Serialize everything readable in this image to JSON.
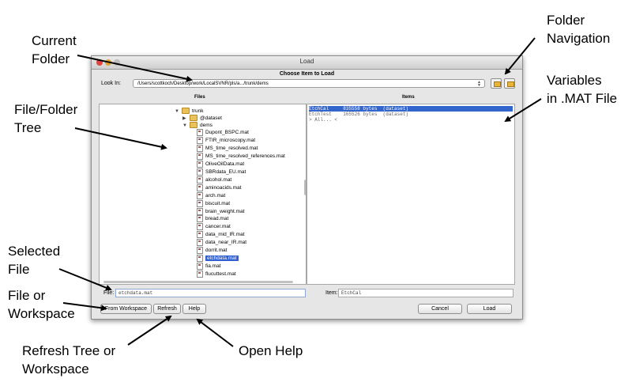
{
  "annotations": {
    "current_folder": "Current\nFolder",
    "folder_navigation": "Folder\nNavigation",
    "file_folder_tree": "File/Folder\nTree",
    "variables": "Variables\nin .MAT File",
    "selected_file": "Selected\nFile",
    "file_or_workspace": "File or\nWorkspace",
    "refresh_tree": "Refresh Tree or\nWorkspace",
    "open_help": "Open Help"
  },
  "window": {
    "title": "Load",
    "heading": "Choose Item to Load",
    "look_in_label": "Look In:",
    "look_in_path": "/Users/scottkoch/Desktop/work/LocalSVNR/pls/a.../trunk/dems",
    "files_header": "Files",
    "items_header": "Items"
  },
  "tree": {
    "trunk": "trunk",
    "dataset": "@dataset",
    "dems": "dems",
    "files": [
      "Dupont_BSPC.mat",
      "FTIR_microscopy.mat",
      "MS_time_resolved.mat",
      "MS_time_resolved_references.mat",
      "OliveOilData.mat",
      "SBRdata_EU.mat",
      "alcohol.mat",
      "aminoacids.mat",
      "arch.mat",
      "biscuit.mat",
      "brain_weight.mat",
      "bread.mat",
      "cancer.mat",
      "data_mid_IR.mat",
      "data_near_IR.mat",
      "dorrit.mat",
      "etchdata.mat",
      "fia.mat",
      "flucuttest.mat"
    ],
    "selected_file": "etchdata.mat"
  },
  "items": [
    {
      "text": "EtchCal     835558 bytes  (dataset)",
      "selected": true
    },
    {
      "text": "EtchTest    165526 bytes  (dataset)",
      "selected": false
    },
    {
      "text": "> All... <",
      "selected": false
    }
  ],
  "bottom": {
    "file_label": "File:",
    "file_value": "etchdata.mat",
    "item_label": "Item:",
    "item_value": "EtchCal",
    "from_workspace": "From Workspace",
    "refresh": "Refresh",
    "help": "Help",
    "cancel": "Cancel",
    "load": "Load"
  },
  "icons": {
    "folder_up": "folder-up-icon",
    "folder_open": "folder-open-icon"
  },
  "colors": {
    "selection": "#2f5fd0",
    "folder": "#e9c35a"
  }
}
